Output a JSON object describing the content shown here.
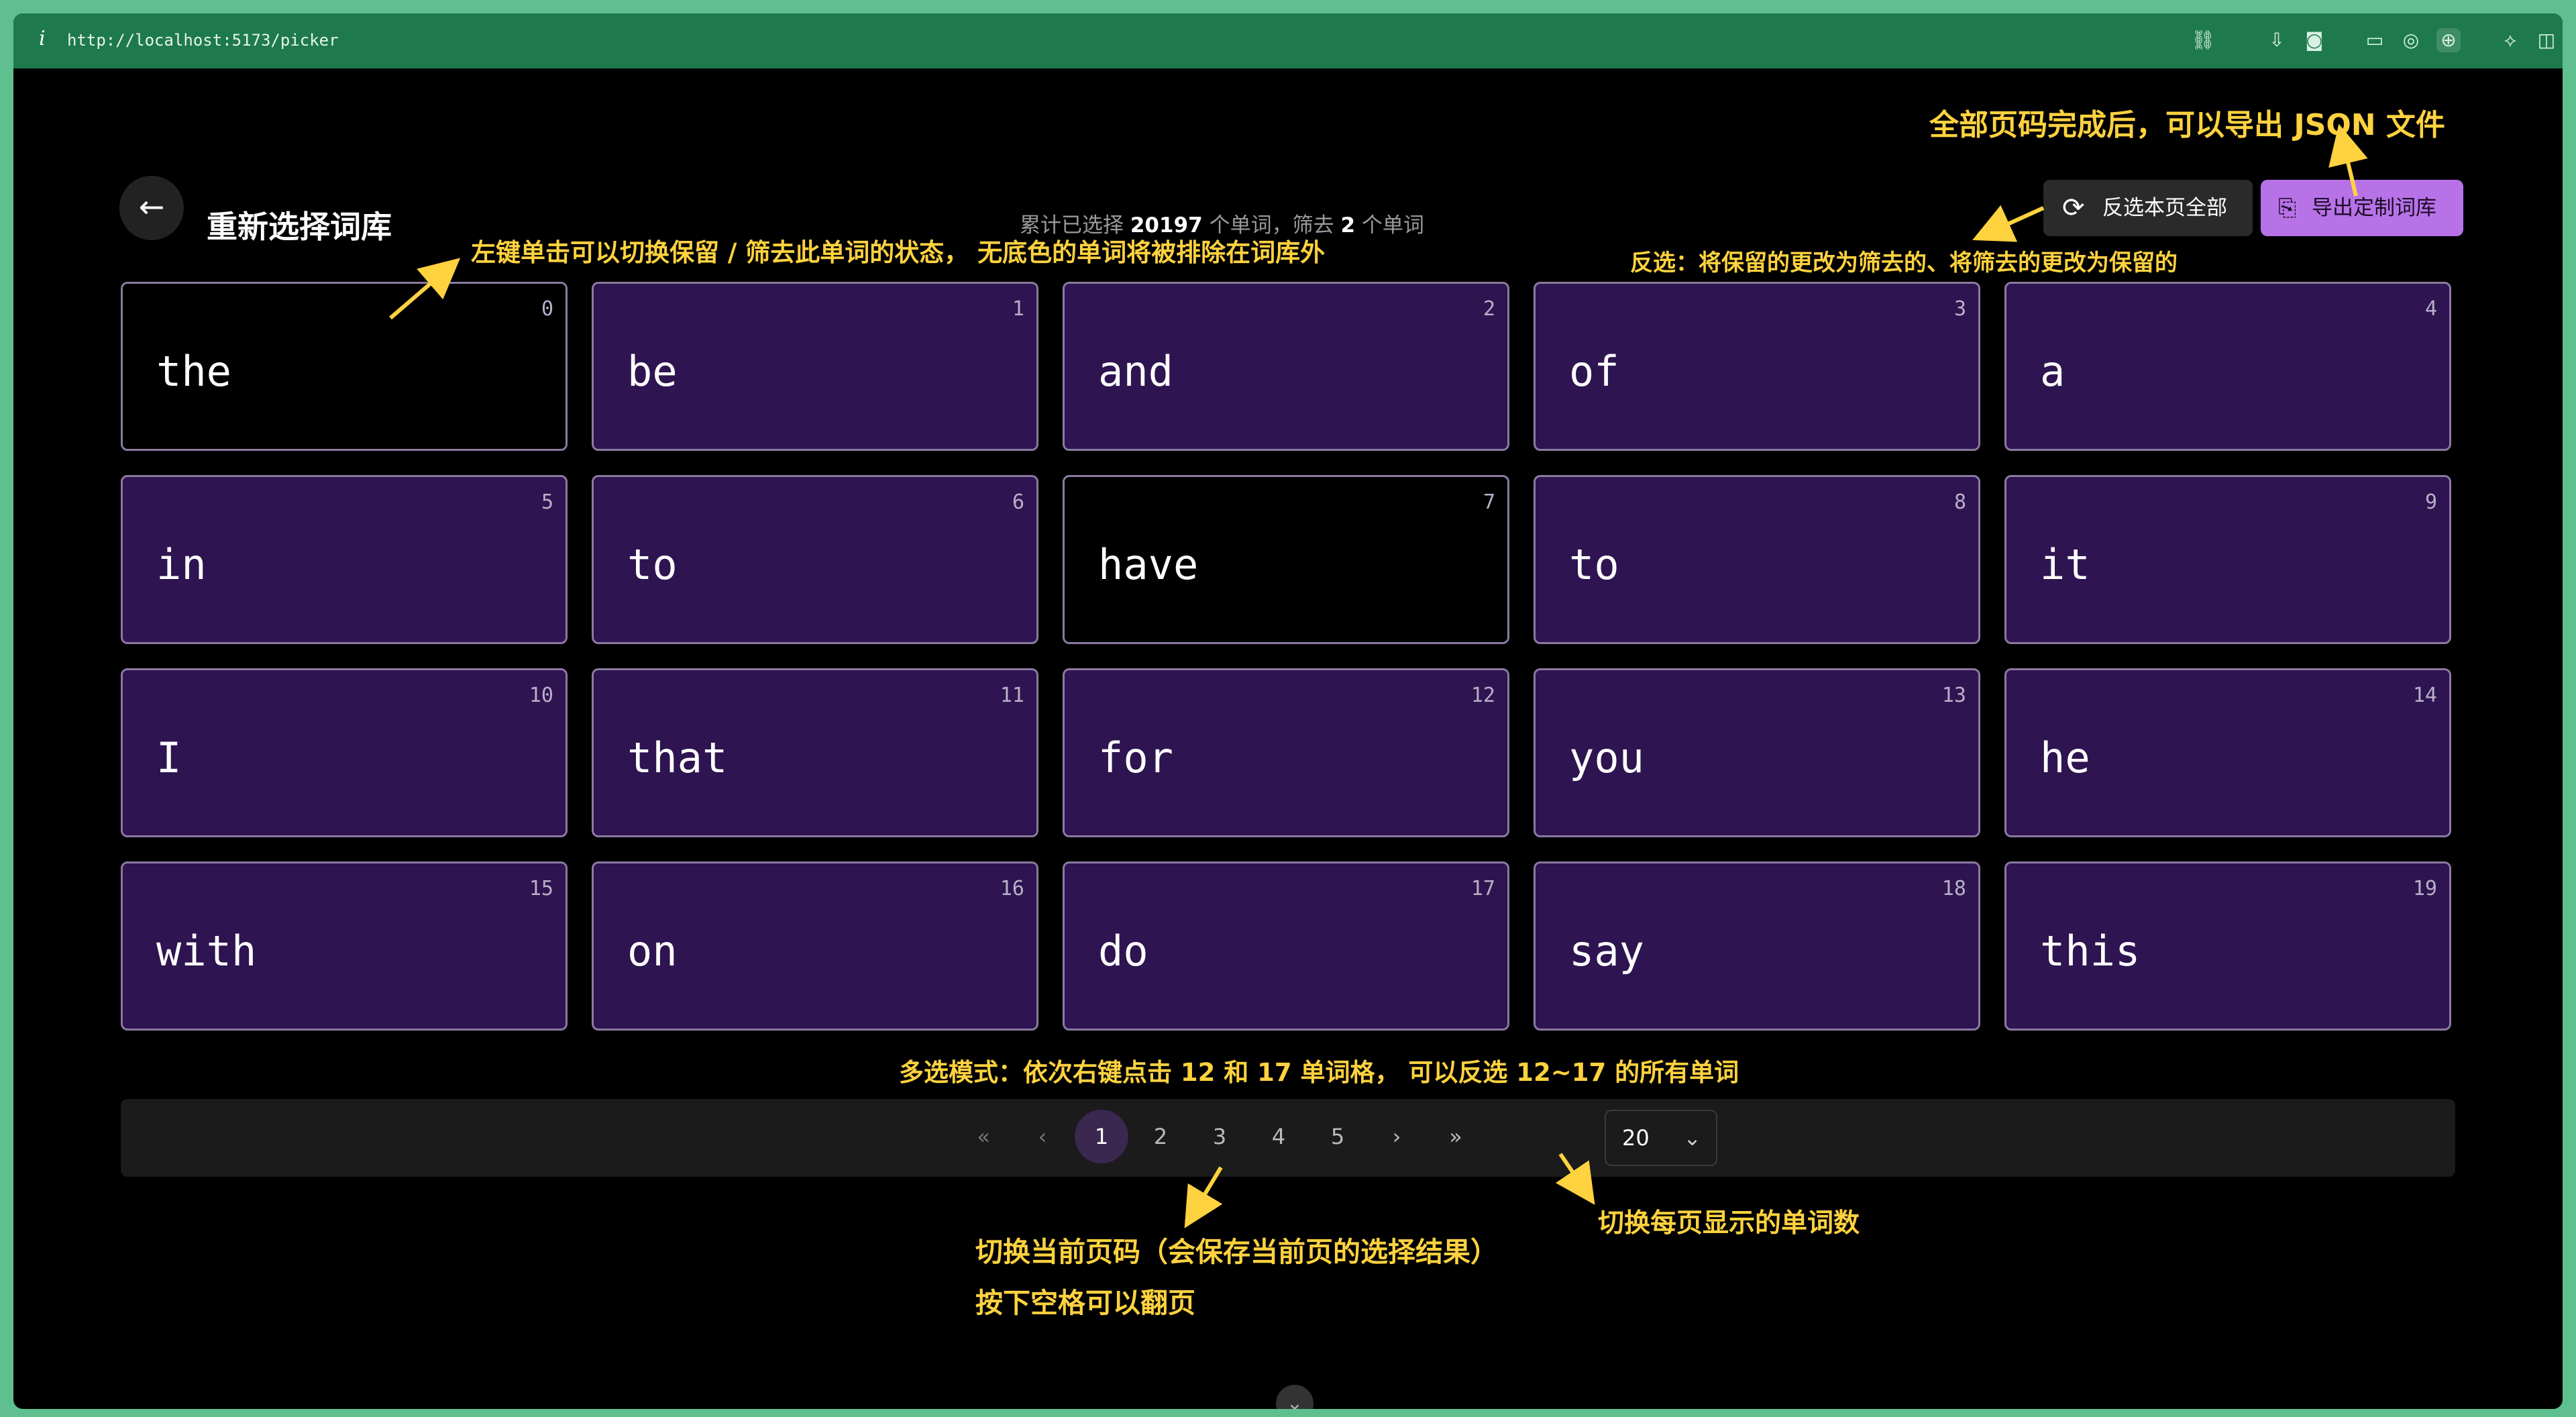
{
  "browser": {
    "info_icon": "info-icon",
    "url": "http://localhost:5173/picker"
  },
  "header": {
    "back_icon": "arrow-left-icon",
    "title": "重新选择词库",
    "stats": {
      "prefix": "累计已选择",
      "selected_count": "20197",
      "middle": "个单词，筛去",
      "filtered_count": "2",
      "suffix": "个单词"
    },
    "invert_button": {
      "icon": "refresh-icon",
      "label": "反选本页全部"
    },
    "export_button": {
      "icon": "export-icon",
      "label": "导出定制词库"
    }
  },
  "words": [
    {
      "index": "0",
      "word": "the",
      "kept": false
    },
    {
      "index": "1",
      "word": "be",
      "kept": true
    },
    {
      "index": "2",
      "word": "and",
      "kept": true
    },
    {
      "index": "3",
      "word": "of",
      "kept": true
    },
    {
      "index": "4",
      "word": "a",
      "kept": true
    },
    {
      "index": "5",
      "word": "in",
      "kept": true
    },
    {
      "index": "6",
      "word": "to",
      "kept": true
    },
    {
      "index": "7",
      "word": "have",
      "kept": false
    },
    {
      "index": "8",
      "word": "to",
      "kept": true
    },
    {
      "index": "9",
      "word": "it",
      "kept": true
    },
    {
      "index": "10",
      "word": "I",
      "kept": true
    },
    {
      "index": "11",
      "word": "that",
      "kept": true
    },
    {
      "index": "12",
      "word": "for",
      "kept": true
    },
    {
      "index": "13",
      "word": "you",
      "kept": true
    },
    {
      "index": "14",
      "word": "he",
      "kept": true
    },
    {
      "index": "15",
      "word": "with",
      "kept": true
    },
    {
      "index": "16",
      "word": "on",
      "kept": true
    },
    {
      "index": "17",
      "word": "do",
      "kept": true
    },
    {
      "index": "18",
      "word": "say",
      "kept": true
    },
    {
      "index": "19",
      "word": "this",
      "kept": true
    }
  ],
  "pagination": {
    "first": "«",
    "prev": "‹",
    "pages": [
      "1",
      "2",
      "3",
      "4",
      "5"
    ],
    "current": "1",
    "next": "›",
    "last": "»",
    "page_size": "20"
  },
  "annotations": {
    "export_tip": "全部页码完成后，可以导出 JSON 文件",
    "toggle_tip": "左键单击可以切换保留 / 筛去此单词的状态， 无底色的单词将被排除在词库外",
    "invert_tip": "反选：将保留的更改为筛去的、将筛去的更改为保留的",
    "multiselect_tip": "多选模式：依次右键点击 12 和 17 单词格， 可以反选 12~17 的所有单词",
    "page_tip_line1": "切换当前页码（会保存当前页的选择结果）",
    "page_tip_line2": "按下空格可以翻页",
    "pagesize_tip": "切换每页显示的单词数"
  },
  "colors": {
    "kept_cell": "#2e1450",
    "filtered_cell": "#000000",
    "annotation": "#ffd23f",
    "export_button": "#b872e8",
    "browser_bar": "#1e7a4c"
  }
}
